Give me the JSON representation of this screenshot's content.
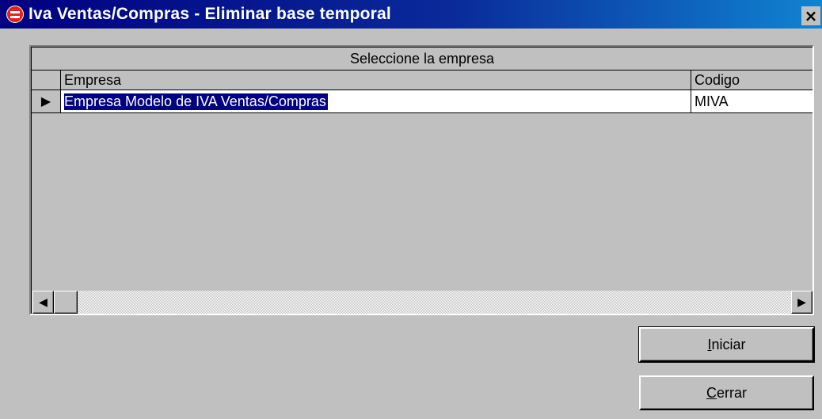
{
  "window": {
    "title": "Iva Ventas/Compras - Eliminar base temporal",
    "close_glyph": "×"
  },
  "grid": {
    "caption": "Seleccione la empresa",
    "columns": [
      "Empresa",
      "Codigo"
    ],
    "rows": [
      {
        "empresa": "Empresa Modelo de IVA Ventas/Compras",
        "codigo": "MIVA",
        "selected": true
      }
    ],
    "row_indicator_glyph": "▶"
  },
  "scrollbar": {
    "left_glyph": "◀",
    "right_glyph": "▶"
  },
  "buttons": {
    "iniciar": {
      "access_key": "I",
      "rest": "niciar"
    },
    "cerrar": {
      "access_key": "C",
      "rest": "errar"
    }
  },
  "colors": {
    "titlebar_start": "#000080",
    "titlebar_end": "#1084d0",
    "selection": "#000080",
    "face": "#c0c0c0"
  }
}
